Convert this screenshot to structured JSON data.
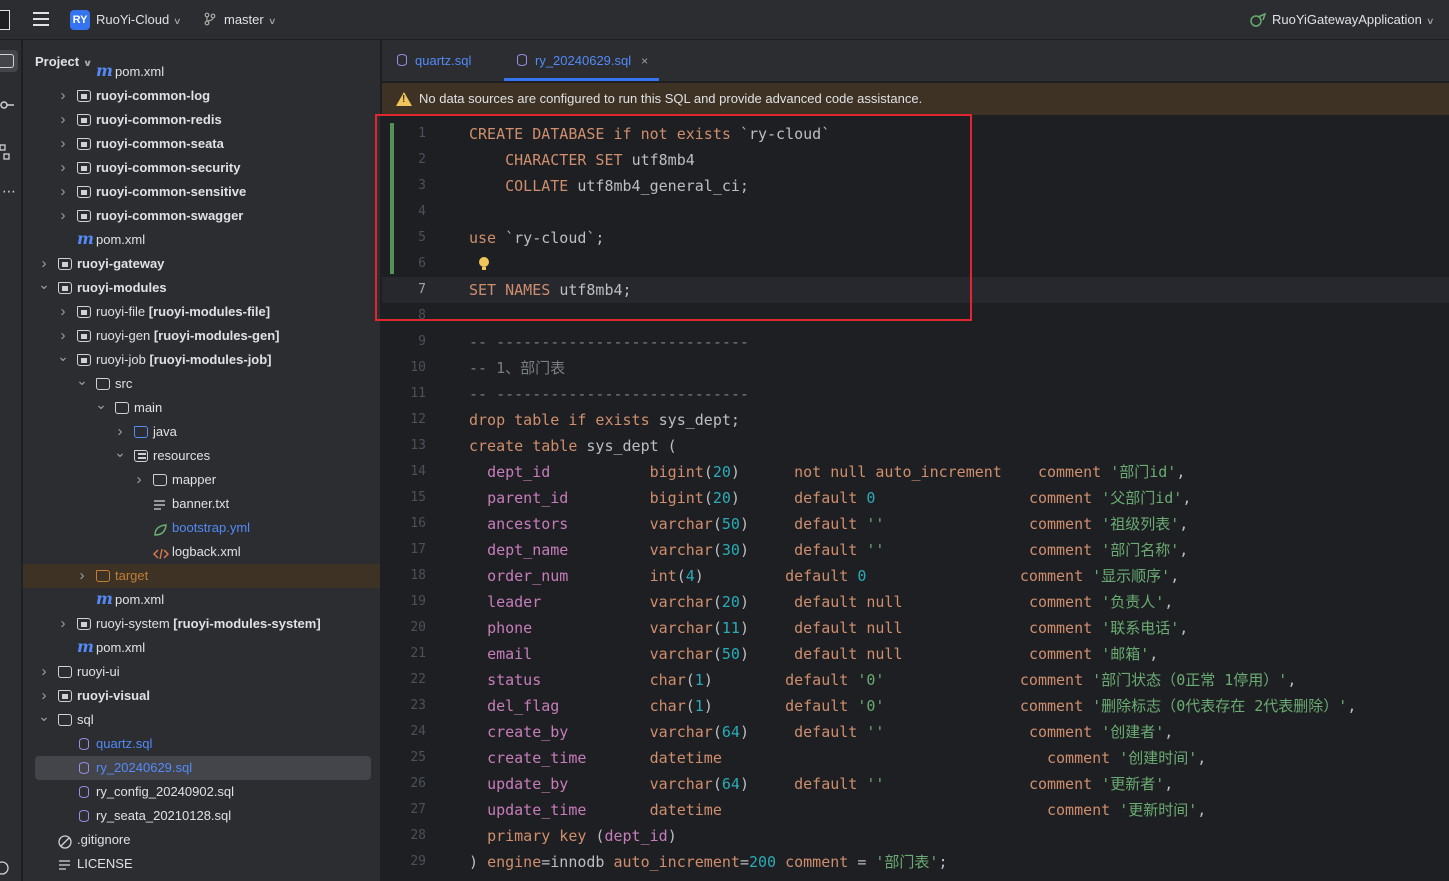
{
  "titlebar": {
    "project_badge": "RY",
    "project_name": "RuoYi-Cloud",
    "branch": "master",
    "run_config": "RuoYiGatewayApplication"
  },
  "project_panel": {
    "title": "Project",
    "tree": [
      {
        "label": "pom.xml",
        "icon": "maven-icon",
        "level": 4,
        "bold": false,
        "arrow": "",
        "partial": true
      },
      {
        "label": "ruoyi-common-log",
        "icon": "module-folder-icon",
        "level": 3,
        "bold": true,
        "arrow": "right"
      },
      {
        "label": "ruoyi-common-redis",
        "icon": "module-folder-icon",
        "level": 3,
        "bold": true,
        "arrow": "right"
      },
      {
        "label": "ruoyi-common-seata",
        "icon": "module-folder-icon",
        "level": 3,
        "bold": true,
        "arrow": "right"
      },
      {
        "label": "ruoyi-common-security",
        "icon": "module-folder-icon",
        "level": 3,
        "bold": true,
        "arrow": "right"
      },
      {
        "label": "ruoyi-common-sensitive",
        "icon": "module-folder-icon",
        "level": 3,
        "bold": true,
        "arrow": "right"
      },
      {
        "label": "ruoyi-common-swagger",
        "icon": "module-folder-icon",
        "level": 3,
        "bold": true,
        "arrow": "right"
      },
      {
        "label": "pom.xml",
        "icon": "maven-icon",
        "level": 3,
        "bold": false,
        "arrow": ""
      },
      {
        "label": "ruoyi-gateway",
        "icon": "module-folder-icon",
        "level": 2,
        "bold": true,
        "arrow": "right"
      },
      {
        "label": "ruoyi-modules",
        "icon": "module-folder-icon",
        "level": 2,
        "bold": true,
        "arrow": "down"
      },
      {
        "label": "ruoyi-file ",
        "suffix": "[ruoyi-modules-file]",
        "icon": "module-folder-icon",
        "level": 3,
        "bold": false,
        "arrow": "right"
      },
      {
        "label": "ruoyi-gen ",
        "suffix": "[ruoyi-modules-gen]",
        "icon": "module-folder-icon",
        "level": 3,
        "bold": false,
        "arrow": "right"
      },
      {
        "label": "ruoyi-job ",
        "suffix": "[ruoyi-modules-job]",
        "icon": "module-folder-icon",
        "level": 3,
        "bold": false,
        "arrow": "down"
      },
      {
        "label": "src",
        "icon": "folder-icon",
        "level": 4,
        "bold": false,
        "arrow": "down"
      },
      {
        "label": "main",
        "icon": "folder-icon",
        "level": 5,
        "bold": false,
        "arrow": "down"
      },
      {
        "label": "java",
        "icon": "source-folder-icon",
        "level": 6,
        "bold": false,
        "arrow": "right"
      },
      {
        "label": "resources",
        "icon": "resources-folder-icon",
        "level": 6,
        "bold": false,
        "arrow": "down"
      },
      {
        "label": "mapper",
        "icon": "folder-icon",
        "level": 7,
        "bold": false,
        "arrow": "right"
      },
      {
        "label": "banner.txt",
        "icon": "text-file-icon",
        "level": 7,
        "bold": false,
        "arrow": ""
      },
      {
        "label": "bootstrap.yml",
        "icon": "spring-yaml-icon",
        "level": 7,
        "bold": false,
        "arrow": "",
        "color": "blue"
      },
      {
        "label": "logback.xml",
        "icon": "xml-file-icon",
        "level": 7,
        "bold": false,
        "arrow": ""
      },
      {
        "label": "target",
        "icon": "excluded-folder-icon",
        "level": 4,
        "bold": false,
        "arrow": "right",
        "color": "orange",
        "excluded": true
      },
      {
        "label": "pom.xml",
        "icon": "maven-icon",
        "level": 4,
        "bold": false,
        "arrow": ""
      },
      {
        "label": "ruoyi-system ",
        "suffix": "[ruoyi-modules-system]",
        "icon": "module-folder-icon",
        "level": 3,
        "bold": false,
        "arrow": "right"
      },
      {
        "label": "pom.xml",
        "icon": "maven-icon",
        "level": 3,
        "bold": false,
        "arrow": ""
      },
      {
        "label": "ruoyi-ui",
        "icon": "folder-icon",
        "level": 2,
        "bold": false,
        "arrow": "right"
      },
      {
        "label": "ruoyi-visual",
        "icon": "module-folder-icon",
        "level": 2,
        "bold": true,
        "arrow": "right"
      },
      {
        "label": "sql",
        "icon": "folder-icon",
        "level": 2,
        "bold": false,
        "arrow": "down"
      },
      {
        "label": "quartz.sql",
        "icon": "sql-file-icon",
        "level": 3,
        "bold": false,
        "arrow": "",
        "color": "blue"
      },
      {
        "label": "ry_20240629.sql",
        "icon": "sql-file-icon",
        "level": 3,
        "bold": false,
        "arrow": "",
        "color": "blue",
        "selected": true
      },
      {
        "label": "ry_config_20240902.sql",
        "icon": "sql-file-icon",
        "level": 3,
        "bold": false,
        "arrow": ""
      },
      {
        "label": "ry_seata_20210128.sql",
        "icon": "sql-file-icon",
        "level": 3,
        "bold": false,
        "arrow": ""
      },
      {
        "label": ".gitignore",
        "icon": "ignore-file-icon",
        "level": 2,
        "bold": false,
        "arrow": ""
      },
      {
        "label": "LICENSE",
        "icon": "text-file-icon",
        "level": 2,
        "bold": false,
        "arrow": ""
      }
    ]
  },
  "editor": {
    "tabs": [
      {
        "label": "quartz.sql",
        "active": false
      },
      {
        "label": "ry_20240629.sql",
        "active": true,
        "close": "×"
      }
    ],
    "banner": "No data sources are configured to run this SQL and provide advanced code assistance.",
    "current_line": 7,
    "lines": [
      [
        [
          "k",
          "CREATE DATABASE if not exists "
        ],
        [
          "t",
          "`ry-cloud`"
        ]
      ],
      [
        [
          "t",
          "    "
        ],
        [
          "k",
          "CHARACTER SET "
        ],
        [
          "t",
          "utf8mb4"
        ]
      ],
      [
        [
          "t",
          "    "
        ],
        [
          "k",
          "COLLATE "
        ],
        [
          "t",
          "utf8mb4_general_ci;"
        ]
      ],
      [],
      [
        [
          "k",
          "use "
        ],
        [
          "t",
          "`ry-cloud`;"
        ]
      ],
      [],
      [
        [
          "k",
          "SET NAMES "
        ],
        [
          "t",
          "utf8mb4;"
        ]
      ],
      [],
      [
        [
          "c",
          "-- ----------------------------"
        ]
      ],
      [
        [
          "c",
          "-- 1、部门表"
        ]
      ],
      [
        [
          "c",
          "-- ----------------------------"
        ]
      ],
      [
        [
          "k",
          "drop table if exists "
        ],
        [
          "t",
          "sys_dept;"
        ]
      ],
      [
        [
          "k",
          "create table "
        ],
        [
          "t",
          "sys_dept ("
        ]
      ],
      [
        [
          "t",
          "  "
        ],
        [
          "f",
          "dept_id"
        ],
        [
          "t",
          "           "
        ],
        [
          "k",
          "bigint"
        ],
        [
          "t",
          "("
        ],
        [
          "n",
          "20"
        ],
        [
          "t",
          ")      "
        ],
        [
          "k",
          "not null auto_increment"
        ],
        [
          "t",
          "    "
        ],
        [
          "k",
          "comment "
        ],
        [
          "s",
          "'部门id'"
        ],
        [
          "t",
          ","
        ]
      ],
      [
        [
          "t",
          "  "
        ],
        [
          "f",
          "parent_id"
        ],
        [
          "t",
          "         "
        ],
        [
          "k",
          "bigint"
        ],
        [
          "t",
          "("
        ],
        [
          "n",
          "20"
        ],
        [
          "t",
          ")      "
        ],
        [
          "k",
          "default "
        ],
        [
          "n",
          "0"
        ],
        [
          "t",
          "                 "
        ],
        [
          "k",
          "comment "
        ],
        [
          "s",
          "'父部门id'"
        ],
        [
          "t",
          ","
        ]
      ],
      [
        [
          "t",
          "  "
        ],
        [
          "f",
          "ancestors"
        ],
        [
          "t",
          "         "
        ],
        [
          "k",
          "varchar"
        ],
        [
          "t",
          "("
        ],
        [
          "n",
          "50"
        ],
        [
          "t",
          ")     "
        ],
        [
          "k",
          "default "
        ],
        [
          "s",
          "''"
        ],
        [
          "t",
          "                "
        ],
        [
          "k",
          "comment "
        ],
        [
          "s",
          "'祖级列表'"
        ],
        [
          "t",
          ","
        ]
      ],
      [
        [
          "t",
          "  "
        ],
        [
          "f",
          "dept_name"
        ],
        [
          "t",
          "         "
        ],
        [
          "k",
          "varchar"
        ],
        [
          "t",
          "("
        ],
        [
          "n",
          "30"
        ],
        [
          "t",
          ")     "
        ],
        [
          "k",
          "default "
        ],
        [
          "s",
          "''"
        ],
        [
          "t",
          "                "
        ],
        [
          "k",
          "comment "
        ],
        [
          "s",
          "'部门名称'"
        ],
        [
          "t",
          ","
        ]
      ],
      [
        [
          "t",
          "  "
        ],
        [
          "f",
          "order_num"
        ],
        [
          "t",
          "         "
        ],
        [
          "k",
          "int"
        ],
        [
          "t",
          "("
        ],
        [
          "n",
          "4"
        ],
        [
          "t",
          ")         "
        ],
        [
          "k",
          "default "
        ],
        [
          "n",
          "0"
        ],
        [
          "t",
          "                 "
        ],
        [
          "k",
          "comment "
        ],
        [
          "s",
          "'显示顺序'"
        ],
        [
          "t",
          ","
        ]
      ],
      [
        [
          "t",
          "  "
        ],
        [
          "f",
          "leader"
        ],
        [
          "t",
          "            "
        ],
        [
          "k",
          "varchar"
        ],
        [
          "t",
          "("
        ],
        [
          "n",
          "20"
        ],
        [
          "t",
          ")     "
        ],
        [
          "k",
          "default null"
        ],
        [
          "t",
          "              "
        ],
        [
          "k",
          "comment "
        ],
        [
          "s",
          "'负责人'"
        ],
        [
          "t",
          ","
        ]
      ],
      [
        [
          "t",
          "  "
        ],
        [
          "f",
          "phone"
        ],
        [
          "t",
          "             "
        ],
        [
          "k",
          "varchar"
        ],
        [
          "t",
          "("
        ],
        [
          "n",
          "11"
        ],
        [
          "t",
          ")     "
        ],
        [
          "k",
          "default null"
        ],
        [
          "t",
          "              "
        ],
        [
          "k",
          "comment "
        ],
        [
          "s",
          "'联系电话'"
        ],
        [
          "t",
          ","
        ]
      ],
      [
        [
          "t",
          "  "
        ],
        [
          "f",
          "email"
        ],
        [
          "t",
          "             "
        ],
        [
          "k",
          "varchar"
        ],
        [
          "t",
          "("
        ],
        [
          "n",
          "50"
        ],
        [
          "t",
          ")     "
        ],
        [
          "k",
          "default null"
        ],
        [
          "t",
          "              "
        ],
        [
          "k",
          "comment "
        ],
        [
          "s",
          "'邮箱'"
        ],
        [
          "t",
          ","
        ]
      ],
      [
        [
          "t",
          "  "
        ],
        [
          "f",
          "status"
        ],
        [
          "t",
          "            "
        ],
        [
          "k",
          "char"
        ],
        [
          "t",
          "("
        ],
        [
          "n",
          "1"
        ],
        [
          "t",
          ")        "
        ],
        [
          "k",
          "default "
        ],
        [
          "s",
          "'0'"
        ],
        [
          "t",
          "               "
        ],
        [
          "k",
          "comment "
        ],
        [
          "s",
          "'部门状态（0正常 1停用）'"
        ],
        [
          "t",
          ","
        ]
      ],
      [
        [
          "t",
          "  "
        ],
        [
          "f",
          "del_flag"
        ],
        [
          "t",
          "          "
        ],
        [
          "k",
          "char"
        ],
        [
          "t",
          "("
        ],
        [
          "n",
          "1"
        ],
        [
          "t",
          ")        "
        ],
        [
          "k",
          "default "
        ],
        [
          "s",
          "'0'"
        ],
        [
          "t",
          "               "
        ],
        [
          "k",
          "comment "
        ],
        [
          "s",
          "'删除标志（0代表存在 2代表删除）'"
        ],
        [
          "t",
          ","
        ]
      ],
      [
        [
          "t",
          "  "
        ],
        [
          "f",
          "create_by"
        ],
        [
          "t",
          "         "
        ],
        [
          "k",
          "varchar"
        ],
        [
          "t",
          "("
        ],
        [
          "n",
          "64"
        ],
        [
          "t",
          ")     "
        ],
        [
          "k",
          "default "
        ],
        [
          "s",
          "''"
        ],
        [
          "t",
          "                "
        ],
        [
          "k",
          "comment "
        ],
        [
          "s",
          "'创建者'"
        ],
        [
          "t",
          ","
        ]
      ],
      [
        [
          "t",
          "  "
        ],
        [
          "f",
          "create_time"
        ],
        [
          "t",
          "       "
        ],
        [
          "k",
          "datetime"
        ],
        [
          "t",
          "                                    "
        ],
        [
          "k",
          "comment "
        ],
        [
          "s",
          "'创建时间'"
        ],
        [
          "t",
          ","
        ]
      ],
      [
        [
          "t",
          "  "
        ],
        [
          "f",
          "update_by"
        ],
        [
          "t",
          "         "
        ],
        [
          "k",
          "varchar"
        ],
        [
          "t",
          "("
        ],
        [
          "n",
          "64"
        ],
        [
          "t",
          ")     "
        ],
        [
          "k",
          "default "
        ],
        [
          "s",
          "''"
        ],
        [
          "t",
          "                "
        ],
        [
          "k",
          "comment "
        ],
        [
          "s",
          "'更新者'"
        ],
        [
          "t",
          ","
        ]
      ],
      [
        [
          "t",
          "  "
        ],
        [
          "f",
          "update_time"
        ],
        [
          "t",
          "       "
        ],
        [
          "k",
          "datetime"
        ],
        [
          "t",
          "                                    "
        ],
        [
          "k",
          "comment "
        ],
        [
          "s",
          "'更新时间'"
        ],
        [
          "t",
          ","
        ]
      ],
      [
        [
          "t",
          "  "
        ],
        [
          "k",
          "primary key "
        ],
        [
          "t",
          "("
        ],
        [
          "f",
          "dept_id"
        ],
        [
          "t",
          ")"
        ]
      ],
      [
        [
          "t",
          ") "
        ],
        [
          "k",
          "engine"
        ],
        [
          "t",
          "=innodb "
        ],
        [
          "k",
          "auto_increment"
        ],
        [
          "t",
          "="
        ],
        [
          "n",
          "200"
        ],
        [
          "t",
          " "
        ],
        [
          "k",
          "comment "
        ],
        [
          "t",
          "= "
        ],
        [
          "s",
          "'部门表'"
        ],
        [
          "t",
          ";"
        ]
      ]
    ]
  },
  "colors": {
    "accent": "#3574f0",
    "keyword": "#cf8e6d",
    "string": "#6aab73",
    "number": "#2aacb8",
    "comment": "#7a7e85",
    "field": "#c77dbb",
    "highlight_box": "#e0262f",
    "warning": "#f2c55c"
  }
}
